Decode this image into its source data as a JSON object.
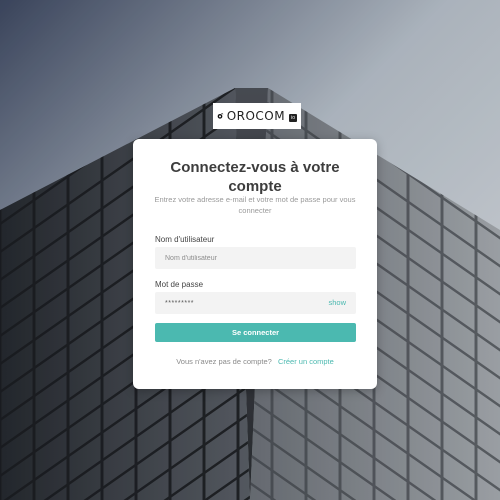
{
  "brand": {
    "name": "OROCOM",
    "badge": "io",
    "accent_color": "#4bb9b0"
  },
  "login": {
    "title": "Connectez-vous à votre compte",
    "subtitle": "Entrez votre adresse e-mail et votre mot de passe pour vous connecter",
    "username": {
      "label": "Nom d'utilisateur",
      "placeholder": "Nom d'utilisateur",
      "value": ""
    },
    "password": {
      "label": "Mot de passe",
      "value": "*********",
      "toggle_label": "show"
    },
    "submit_label": "Se connecter",
    "footer": {
      "text": "Vous n'avez pas de compte?",
      "link_label": "Créer un compte"
    }
  },
  "icons": {
    "logo": "orocom-logo-icon",
    "background": "skyscraper-background"
  }
}
